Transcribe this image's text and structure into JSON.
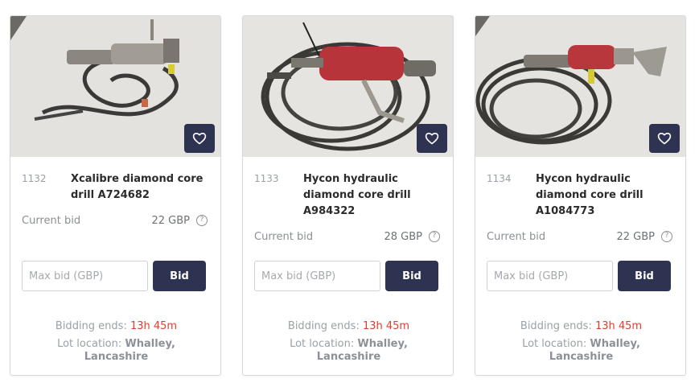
{
  "currency_note": "GBP",
  "colors": {
    "accent": "#2f3352",
    "time": "#e23b2e"
  },
  "lots": [
    {
      "lot_number": "1132",
      "title": "Xcalibre diamond core drill A724682",
      "current_bid_label": "Current bid",
      "current_bid": "22 GBP",
      "max_bid_placeholder": "Max bid (GBP)",
      "bid_button": "Bid",
      "bidding_ends_label": "Bidding ends:",
      "bidding_ends_time": "13h 45m",
      "lot_location_label": "Lot location:",
      "lot_location": "Whalley, Lancashire",
      "favourite_icon": "heart-icon"
    },
    {
      "lot_number": "1133",
      "title": "Hycon hydraulic diamond core drill A984322",
      "current_bid_label": "Current bid",
      "current_bid": "28 GBP",
      "max_bid_placeholder": "Max bid (GBP)",
      "bid_button": "Bid",
      "bidding_ends_label": "Bidding ends:",
      "bidding_ends_time": "13h 45m",
      "lot_location_label": "Lot location:",
      "lot_location": "Whalley, Lancashire",
      "favourite_icon": "heart-icon"
    },
    {
      "lot_number": "1134",
      "title": "Hycon hydraulic diamond core drill A1084773",
      "current_bid_label": "Current bid",
      "current_bid": "22 GBP",
      "max_bid_placeholder": "Max bid (GBP)",
      "bid_button": "Bid",
      "bidding_ends_label": "Bidding ends:",
      "bidding_ends_time": "13h 45m",
      "lot_location_label": "Lot location:",
      "lot_location": "Whalley, Lancashire",
      "favourite_icon": "heart-icon"
    }
  ]
}
